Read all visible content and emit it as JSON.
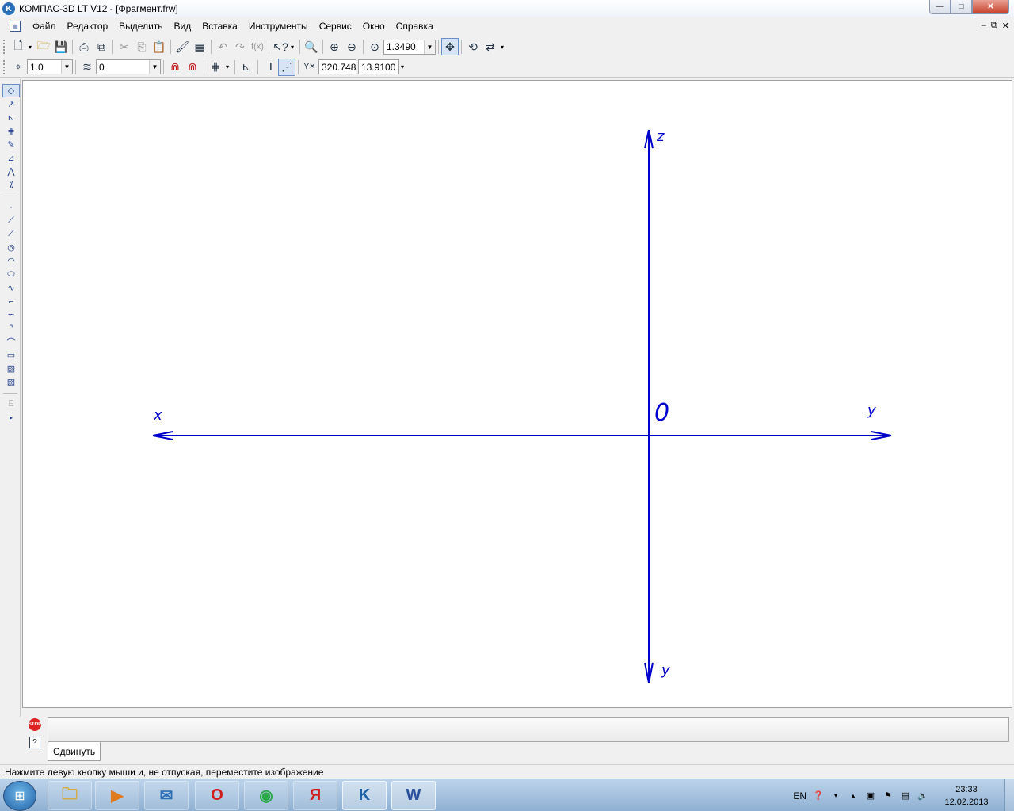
{
  "window": {
    "title": "КОМПАС-3D LT V12 - [Фрагмент.frw]",
    "app_icon": "kompas-logo-icon",
    "controls": {
      "minimize": "—",
      "maximize": "□",
      "close": "✕"
    }
  },
  "menu": {
    "items": [
      "Файл",
      "Редактор",
      "Выделить",
      "Вид",
      "Вставка",
      "Инструменты",
      "Сервис",
      "Окно",
      "Справка"
    ],
    "mdi_controls": {
      "minimize": "–",
      "restore": "⧉",
      "close": "✕"
    }
  },
  "toolbar_standard": {
    "zoom_value": "1.3490"
  },
  "toolbar_current_state": {
    "step_value": "1.0",
    "layer_value": "0",
    "coord_label": "Y",
    "coord_x": "320.748",
    "coord_y": "13.9100"
  },
  "canvas": {
    "axis_color": "#0000cc",
    "labels": {
      "z_top": "z",
      "origin": "0",
      "x_left": "x",
      "y_right": "y",
      "y_bottom": "y"
    }
  },
  "property_panel": {
    "tab_label": "Сдвинуть",
    "stop_icon_text": "STOP",
    "help_icon_text": "?"
  },
  "status": {
    "text": "Нажмите левую кнопку мыши и, не отпуская, переместите изображение"
  },
  "taskbar": {
    "apps": [
      {
        "name": "explorer",
        "icon": "folder-icon",
        "glyph": "🗀",
        "color": "#d9a632"
      },
      {
        "name": "media-player",
        "icon": "media-player-icon",
        "glyph": "▶",
        "color": "#e07a1e"
      },
      {
        "name": "mail",
        "icon": "mail-icon",
        "glyph": "✉",
        "color": "#2a6fb5"
      },
      {
        "name": "opera",
        "icon": "opera-icon",
        "glyph": "O",
        "color": "#d01e1e"
      },
      {
        "name": "chrome",
        "icon": "chrome-icon",
        "glyph": "◉",
        "color": "#2aa84a"
      },
      {
        "name": "yandex",
        "icon": "yandex-icon",
        "glyph": "Я",
        "color": "#d01e1e"
      },
      {
        "name": "kompas",
        "icon": "kompas-icon",
        "glyph": "K",
        "color": "#1f5fa5"
      },
      {
        "name": "word",
        "icon": "word-icon",
        "glyph": "W",
        "color": "#2a4f9a"
      }
    ],
    "language": "EN",
    "time": "23:33",
    "date": "12.02.2013"
  }
}
